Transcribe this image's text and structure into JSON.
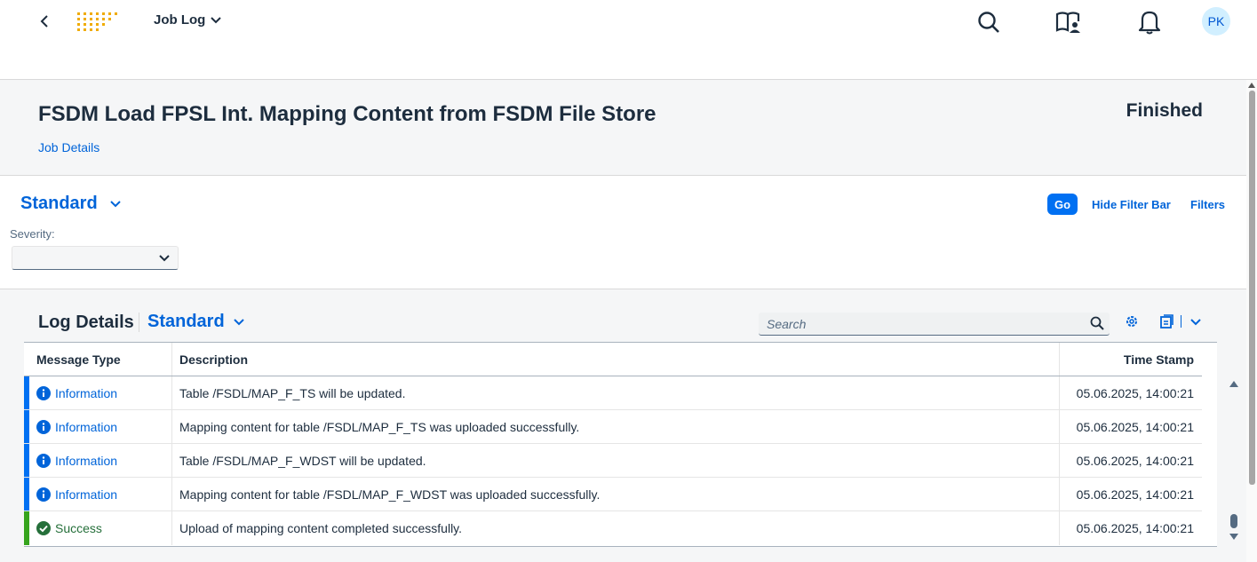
{
  "shell": {
    "app_title": "Job Log",
    "avatar_initials": "PK"
  },
  "object": {
    "title": "FSDM Load FPSL Int. Mapping Content from FSDM File Store",
    "status": "Finished",
    "details_link": "Job Details"
  },
  "filterbar": {
    "variant": "Standard",
    "go_label": "Go",
    "hide_filter_bar": "Hide Filter Bar",
    "filters": "Filters",
    "severity_label": "Severity:",
    "severity_value": ""
  },
  "log": {
    "title": "Log Details",
    "variant": "Standard",
    "search_placeholder": "Search",
    "columns": [
      "Message Type",
      "Description",
      "Time Stamp"
    ],
    "rows": [
      {
        "type": "Information",
        "kind": "info",
        "description": "Table /FSDL/MAP_F_TS will be updated.",
        "timestamp": "05.06.2025, 14:00:21"
      },
      {
        "type": "Information",
        "kind": "info",
        "description": "Mapping content for table /FSDL/MAP_F_TS was uploaded successfully.",
        "timestamp": "05.06.2025, 14:00:21"
      },
      {
        "type": "Information",
        "kind": "info",
        "description": "Table /FSDL/MAP_F_WDST will be updated.",
        "timestamp": "05.06.2025, 14:00:21"
      },
      {
        "type": "Information",
        "kind": "info",
        "description": "Mapping content for table /FSDL/MAP_F_WDST was uploaded successfully.",
        "timestamp": "05.06.2025, 14:00:21"
      },
      {
        "type": "Success",
        "kind": "success",
        "description": "Upload of mapping content completed successfully.",
        "timestamp": "05.06.2025, 14:00:21"
      }
    ]
  },
  "colors": {
    "info": "#0064d9",
    "success": "#256f3a",
    "info_stripe": "#0070f2",
    "success_stripe": "#36a41d"
  },
  "icons": [
    "back-icon",
    "company-logo",
    "chevron-down-icon",
    "search-icon",
    "learning-icon",
    "notification-bell-icon",
    "settings-icon",
    "export-icon",
    "info-icon",
    "success-check-icon"
  ]
}
